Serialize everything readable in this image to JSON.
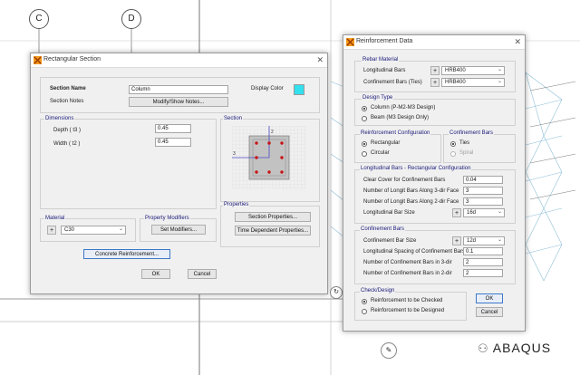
{
  "background": {
    "grid_bubble_c": "C",
    "grid_bubble_d": "D",
    "watermark": "ABAQUS"
  },
  "rect_section": {
    "title": "Rectangular Section",
    "section_name_label": "Section Name",
    "section_name_value": "Column",
    "section_notes_label": "Section Notes",
    "modify_notes_btn": "Modify/Show Notes...",
    "display_color_label": "Display Color",
    "display_color": "#33e0ee",
    "dimensions_title": "Dimensions",
    "depth_label": "Depth  ( t3 )",
    "depth_value": "0.45",
    "width_label": "Width  ( t2 )",
    "width_value": "0.45",
    "section_title": "Section",
    "axis_2": "2",
    "axis_3": "3",
    "properties_title": "Properties",
    "section_properties_btn": "Section Properties...",
    "time_dependent_btn": "Time Dependent Properties...",
    "material_title": "Material",
    "material_plus": "+",
    "material_value": "C30",
    "modifiers_title": "Property Modifiers",
    "set_modifiers_btn": "Set Modifiers...",
    "concrete_reinf_btn": "Concrete Reinforcement...",
    "ok_btn": "OK",
    "cancel_btn": "Cancel"
  },
  "reinf": {
    "title": "Reinforcement Data",
    "rebar_material_title": "Rebar Material",
    "long_bars_label": "Longitudinal Bars",
    "long_bars_value": "HRB400",
    "conf_bars_label": "Confinement Bars  (Ties)",
    "conf_bars_value": "HRB400",
    "design_type_title": "Design Type",
    "column_option": "Column  (P-M2-M3 Design)",
    "beam_option": "Beam  (M3 Design Only)",
    "reinf_config_title": "Reinforcement Configuration",
    "rectangular_option": "Rectangular",
    "circular_option": "Circular",
    "conf_bars_title": "Confinement Bars",
    "ties_option": "Ties",
    "spiral_option": "Spiral",
    "long_rect_title": "Longitudinal Bars - Rectangular Configuration",
    "clear_cover_label": "Clear Cover for Confinement Bars",
    "clear_cover_value": "0.04",
    "num_3dir_label": "Number of Longit Bars Along 3-dir Face",
    "num_3dir_value": "3",
    "num_2dir_label": "Number of Longit Bars Along 2-dir Face",
    "num_2dir_value": "3",
    "long_bar_size_label": "Longitudinal Bar Size",
    "long_bar_size_value": "16d",
    "confinement_title": "Confinement Bars",
    "conf_bar_size_label": "Confinement Bar Size",
    "conf_bar_size_value": "12d",
    "spacing_label": "Longitudinal Spacing of Confinement Bars",
    "spacing_value": "0.1",
    "num_conf_3dir_label": "Number of Confinement Bars in 3-dir",
    "num_conf_3dir_value": "2",
    "num_conf_2dir_label": "Number of Confinement Bars in 2-dir",
    "num_conf_2dir_value": "2",
    "check_design_title": "Check/Design",
    "checked_option": "Reinforcement to be Checked",
    "designed_option": "Reinforcement to be Designed",
    "plus": "+",
    "ok_btn": "OK",
    "cancel_btn": "Cancel"
  }
}
